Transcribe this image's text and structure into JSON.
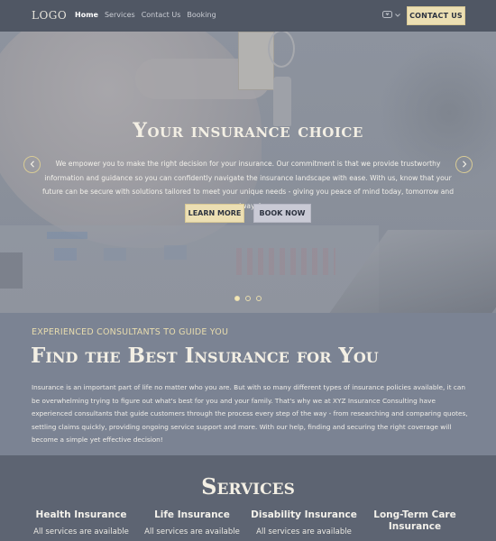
{
  "navbar": {
    "logo": "LOGO",
    "links": [
      {
        "label": "Home",
        "active": true
      },
      {
        "label": "Services",
        "active": false
      },
      {
        "label": "Contact Us",
        "active": false
      },
      {
        "label": "Booking",
        "active": false
      }
    ],
    "language_icon": "message-heart-icon",
    "contact_label": "CONTACT US"
  },
  "hero": {
    "title": "Your insurance choice",
    "text": "We empower you to make the right decision for your insurance. Our commitment is that we provide trustworthy information and guidance so you can confidently navigate the insurance landscape with ease. With us, know that your future can be secure with solutions tailored to meet your unique needs - giving you peace of mind today, tomorrow and always!",
    "learn_more_label": "LEARN MORE",
    "book_now_label": "BOOK NOW",
    "prev_icon": "chevron-left-icon",
    "next_icon": "chevron-right-icon",
    "slides_total": 3,
    "active_slide": 1
  },
  "about": {
    "kicker": "EXPERIENCED CONSULTANTS TO GUIDE YOU",
    "title": "Find the Best Insurance for You",
    "text": "Insurance is an important part of life no matter who you are. But with so many different types of insurance policies available, it can be overwhelming trying to figure out what's best for you and your family. That's why we at XYZ Insurance Consulting have experienced consultants that guide customers through the process every step of the way - from researching and comparing quotes, settling claims quickly, providing ongoing service support and more. With our help, finding and securing the right coverage will become a simple yet effective decision!"
  },
  "services": {
    "title": "Services",
    "items": [
      {
        "name": "Health Insurance",
        "desc": "All services are available"
      },
      {
        "name": "Life Insurance",
        "desc": "All services are available"
      },
      {
        "name": "Disability Insurance",
        "desc": "All services are available"
      },
      {
        "name": "Long-Term Care Insurance",
        "desc": ""
      }
    ]
  },
  "colors": {
    "navbar_bg": "#505764",
    "accent_gold": "#ecdfb3",
    "about_bg": "#7b8393",
    "services_bg": "#5d6472",
    "heading_text": "#f3efe4"
  }
}
